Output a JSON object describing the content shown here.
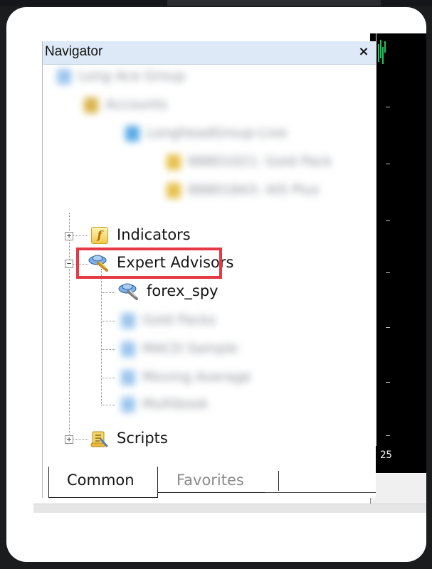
{
  "navigator": {
    "title": "Navigator",
    "close_symbol": "×",
    "blurred_items": [
      "Long Ace Group",
      "Accounts",
      "LongheadGroup-Live",
      "88801021: Gold Pack",
      "88801843: AIS Plus"
    ],
    "tree": {
      "indicators": {
        "label": "Indicators",
        "icon": "function-icon",
        "expander": "+"
      },
      "expert_advisors": {
        "label": "Expert Advisors",
        "icon": "expert-advisor-icon",
        "expander": "−",
        "children": [
          {
            "label": "forex_spy",
            "icon": "expert-advisor-icon",
            "highlighted": true
          }
        ],
        "blurred_children": [
          "Gold Packs",
          "MACD Sample",
          "Moving Average",
          "Multibook"
        ]
      },
      "scripts": {
        "label": "Scripts",
        "icon": "script-icon",
        "expander": "+"
      }
    },
    "tabs": [
      {
        "label": "Common",
        "active": true
      },
      {
        "label": "Favorites",
        "active": false
      }
    ]
  },
  "chart": {
    "axis_label": "25"
  },
  "colors": {
    "header_bg": "#dde9f6",
    "highlight_border": "#e63946",
    "chart_bg": "#000000",
    "chart_line": "#22c55e"
  }
}
